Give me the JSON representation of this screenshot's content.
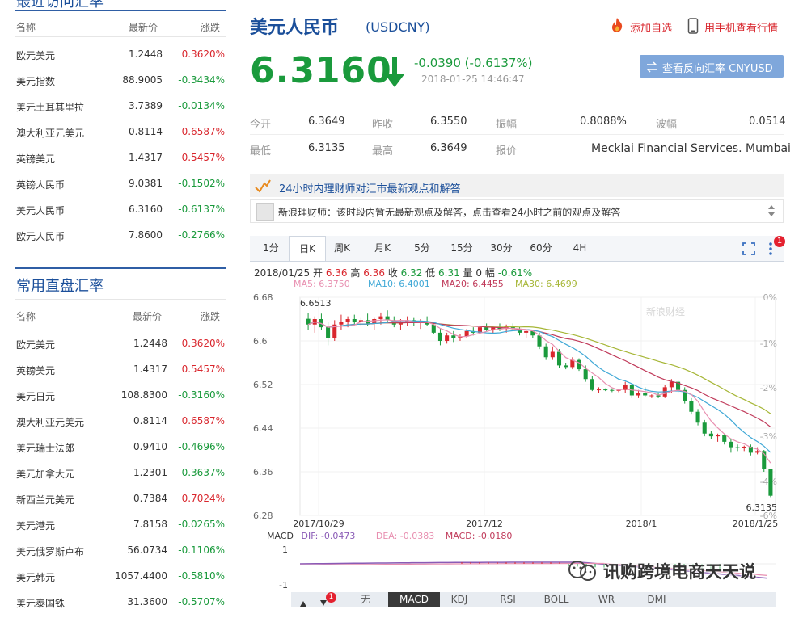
{
  "left_top": {
    "title": "最近访问汇率",
    "headers": {
      "name": "名称",
      "price": "最新价",
      "change": "涨跌"
    },
    "rows": [
      {
        "name": "欧元美元",
        "price": "1.2448",
        "change": "0.3620%",
        "dir": "up"
      },
      {
        "name": "美元指数",
        "price": "88.9005",
        "change": "-0.3434%",
        "dir": "down"
      },
      {
        "name": "美元土耳其里拉",
        "price": "3.7389",
        "change": "-0.0134%",
        "dir": "down"
      },
      {
        "name": "澳大利亚元美元",
        "price": "0.8114",
        "change": "0.6587%",
        "dir": "up"
      },
      {
        "name": "英镑美元",
        "price": "1.4317",
        "change": "0.5457%",
        "dir": "up"
      },
      {
        "name": "英镑人民币",
        "price": "9.0381",
        "change": "-0.1502%",
        "dir": "down"
      },
      {
        "name": "美元人民币",
        "price": "6.3160",
        "change": "-0.6137%",
        "dir": "down"
      },
      {
        "name": "欧元人民币",
        "price": "7.8600",
        "change": "-0.2766%",
        "dir": "down"
      }
    ]
  },
  "left_bottom": {
    "title": "常用直盘汇率",
    "headers": {
      "name": "名称",
      "price": "最新价",
      "change": "涨跌"
    },
    "rows": [
      {
        "name": "欧元美元",
        "price": "1.2448",
        "change": "0.3620%",
        "dir": "up"
      },
      {
        "name": "英镑美元",
        "price": "1.4317",
        "change": "0.5457%",
        "dir": "up"
      },
      {
        "name": "美元日元",
        "price": "108.8300",
        "change": "-0.3160%",
        "dir": "down"
      },
      {
        "name": "澳大利亚元美元",
        "price": "0.8114",
        "change": "0.6587%",
        "dir": "up"
      },
      {
        "name": "美元瑞士法郎",
        "price": "0.9410",
        "change": "-0.4696%",
        "dir": "down"
      },
      {
        "name": "美元加拿大元",
        "price": "1.2301",
        "change": "-0.3637%",
        "dir": "down"
      },
      {
        "name": "新西兰元美元",
        "price": "0.7384",
        "change": "0.7024%",
        "dir": "up"
      },
      {
        "name": "美元港元",
        "price": "7.8158",
        "change": "-0.0265%",
        "dir": "down"
      },
      {
        "name": "美元俄罗斯卢布",
        "price": "56.0734",
        "change": "-0.1106%",
        "dir": "down"
      },
      {
        "name": "美元韩元",
        "price": "1057.4400",
        "change": "-0.5810%",
        "dir": "down"
      },
      {
        "name": "美元泰国铢",
        "price": "31.3600",
        "change": "-0.5707%",
        "dir": "down"
      }
    ]
  },
  "header": {
    "title": "美元人民币",
    "code": "(USDCNY)",
    "add_watch": "添加自选",
    "mobile": "用手机查看行情"
  },
  "quote": {
    "price": "6.3160",
    "change": "-0.0390 (-0.6137%)",
    "time": "2018-01-25 14:46:47",
    "reverse_button": "查看反向汇率 CNYUSD"
  },
  "stats": {
    "open_label": "今开",
    "open": "6.3649",
    "prev_label": "昨收",
    "prev": "6.3550",
    "amp_label": "振幅",
    "amp": "0.8088%",
    "wave_label": "波幅",
    "wave": "0.0514",
    "low_label": "最低",
    "low": "6.3135",
    "high_label": "最高",
    "high": "6.3649",
    "quote_label": "报价",
    "quote_source": "Mecklai Financial Services. Mumbai"
  },
  "advice": {
    "banner": "24小时内理财师对汇市最新观点和解答",
    "message": "新浪理财师：该时段内暂无最新观点及解答，点击查看24小时之前的观点及解答"
  },
  "chart_tabs": [
    "1分",
    "日K",
    "周K",
    "月K",
    "5分",
    "15分",
    "30分",
    "60分",
    "4H"
  ],
  "chart_badge": "1",
  "chart_info": {
    "date": "2018/01/25",
    "open_label": "开",
    "open": "6.36",
    "high_label": "高",
    "high": "6.36",
    "close_label": "收",
    "close": "6.32",
    "low_label": "低",
    "low": "6.31",
    "vol_label": "量",
    "vol": "0",
    "amp_label": "幅",
    "amp": "-0.61%"
  },
  "ma_legend": {
    "ma5": "MA5: 6.3750",
    "ma10": "MA10: 6.4001",
    "ma20": "MA20: 6.4455",
    "ma30": "MA30: 6.4699"
  },
  "colors": {
    "ma5": "#e88fb0",
    "ma10": "#3fa8d6",
    "ma20": "#c03a5a",
    "ma30": "#a6b636",
    "up": "#d9272e",
    "down": "#1a9a3c"
  },
  "chart_data": {
    "type": "candlestick",
    "y_ticks": [
      "6.68",
      "6.6",
      "6.52",
      "6.44",
      "6.36",
      "6.28"
    ],
    "pct_ticks": [
      "0%",
      "-1%",
      "-2%",
      "-3%",
      "-4%",
      "-6%"
    ],
    "x_ticks": [
      "2017/10/29",
      "2017/12",
      "2018/1",
      "2018/1/25"
    ],
    "ylim": [
      6.28,
      6.68
    ],
    "max_label": "6.6513",
    "last_label": "6.3135",
    "watermark": "新浪财经",
    "ohlc": [
      [
        6.6405,
        6.6513,
        6.62,
        6.63
      ],
      [
        6.63,
        6.645,
        6.615,
        6.64
      ],
      [
        6.64,
        6.65,
        6.62,
        6.625
      ],
      [
        6.625,
        6.635,
        6.592,
        6.605
      ],
      [
        6.605,
        6.638,
        6.6,
        6.63
      ],
      [
        6.63,
        6.648,
        6.62,
        6.635
      ],
      [
        6.635,
        6.645,
        6.625,
        6.64
      ],
      [
        6.64,
        6.648,
        6.63,
        6.635
      ],
      [
        6.635,
        6.642,
        6.628,
        6.638
      ],
      [
        6.638,
        6.65,
        6.628,
        6.632
      ],
      [
        6.632,
        6.642,
        6.62,
        6.64
      ],
      [
        6.64,
        6.652,
        6.63,
        6.645
      ],
      [
        6.645,
        6.656,
        6.635,
        6.638
      ],
      [
        6.638,
        6.645,
        6.625,
        6.63
      ],
      [
        6.63,
        6.64,
        6.62,
        6.635
      ],
      [
        6.635,
        6.645,
        6.628,
        6.638
      ],
      [
        6.638,
        6.642,
        6.628,
        6.633
      ],
      [
        6.633,
        6.64,
        6.622,
        6.636
      ],
      [
        6.636,
        6.645,
        6.628,
        6.63
      ],
      [
        6.63,
        6.635,
        6.612,
        6.615
      ],
      [
        6.615,
        6.622,
        6.592,
        6.6
      ],
      [
        6.6,
        6.615,
        6.595,
        6.61
      ],
      [
        6.61,
        6.618,
        6.598,
        6.605
      ],
      [
        6.605,
        6.612,
        6.6,
        6.608
      ],
      [
        6.608,
        6.622,
        6.605,
        6.618
      ],
      [
        6.618,
        6.625,
        6.61,
        6.615
      ],
      [
        6.615,
        6.63,
        6.612,
        6.625
      ],
      [
        6.625,
        6.632,
        6.618,
        6.62
      ],
      [
        6.62,
        6.628,
        6.612,
        6.625
      ],
      [
        6.625,
        6.632,
        6.618,
        6.622
      ],
      [
        6.622,
        6.63,
        6.615,
        6.626
      ],
      [
        6.626,
        6.632,
        6.618,
        6.622
      ],
      [
        6.622,
        6.625,
        6.61,
        6.615
      ],
      [
        6.615,
        6.62,
        6.605,
        6.618
      ],
      [
        6.618,
        6.62,
        6.605,
        6.61
      ],
      [
        6.61,
        6.615,
        6.585,
        6.59
      ],
      [
        6.59,
        6.595,
        6.565,
        6.57
      ],
      [
        6.57,
        6.59,
        6.565,
        6.58
      ],
      [
        6.58,
        6.585,
        6.55,
        6.555
      ],
      [
        6.555,
        6.56,
        6.548,
        6.552
      ],
      [
        6.552,
        6.57,
        6.548,
        6.565
      ],
      [
        6.565,
        6.568,
        6.545,
        6.548
      ],
      [
        6.548,
        6.555,
        6.525,
        6.53
      ],
      [
        6.53,
        6.535,
        6.508,
        6.51
      ],
      [
        6.51,
        6.515,
        6.505,
        6.511
      ],
      [
        6.511,
        6.513,
        6.508,
        6.51
      ],
      [
        6.51,
        6.513,
        6.506,
        6.509
      ],
      [
        6.509,
        6.512,
        6.506,
        6.51
      ],
      [
        6.51,
        6.525,
        6.505,
        6.52
      ],
      [
        6.52,
        6.522,
        6.495,
        6.5
      ],
      [
        6.5,
        6.51,
        6.495,
        6.505
      ],
      [
        6.505,
        6.515,
        6.498,
        6.5
      ],
      [
        6.5,
        6.502,
        6.495,
        6.5
      ],
      [
        6.5,
        6.505,
        6.495,
        6.498
      ],
      [
        6.498,
        6.52,
        6.495,
        6.515
      ],
      [
        6.515,
        6.53,
        6.505,
        6.525
      ],
      [
        6.525,
        6.528,
        6.505,
        6.51
      ],
      [
        6.51,
        6.515,
        6.485,
        6.49
      ],
      [
        6.49,
        6.495,
        6.465,
        6.47
      ],
      [
        6.47,
        6.475,
        6.445,
        6.45
      ],
      [
        6.45,
        6.455,
        6.425,
        6.43
      ],
      [
        6.43,
        6.435,
        6.42,
        6.425
      ],
      [
        6.425,
        6.43,
        6.415,
        6.427
      ],
      [
        6.427,
        6.43,
        6.41,
        6.415
      ],
      [
        6.415,
        6.42,
        6.395,
        6.405
      ],
      [
        6.405,
        6.41,
        6.398,
        6.403
      ],
      [
        6.403,
        6.408,
        6.398,
        6.406
      ],
      [
        6.406,
        6.41,
        6.39,
        6.395
      ],
      [
        6.395,
        6.405,
        6.392,
        6.398
      ],
      [
        6.398,
        6.4,
        6.36,
        6.365
      ],
      [
        6.365,
        6.365,
        6.3135,
        6.316
      ]
    ]
  },
  "macd": {
    "label": "MACD",
    "dif": "DIF: -0.0473",
    "dea": "DEA: -0.0383",
    "macd": "MACD: -0.0180",
    "y_ticks": [
      "1",
      "-1"
    ]
  },
  "bottom_tabs": [
    "无",
    "MACD",
    "KDJ",
    "RSI",
    "BOLL",
    "WR",
    "DMI"
  ],
  "watermark_text": "讯购跨境电商天天说"
}
